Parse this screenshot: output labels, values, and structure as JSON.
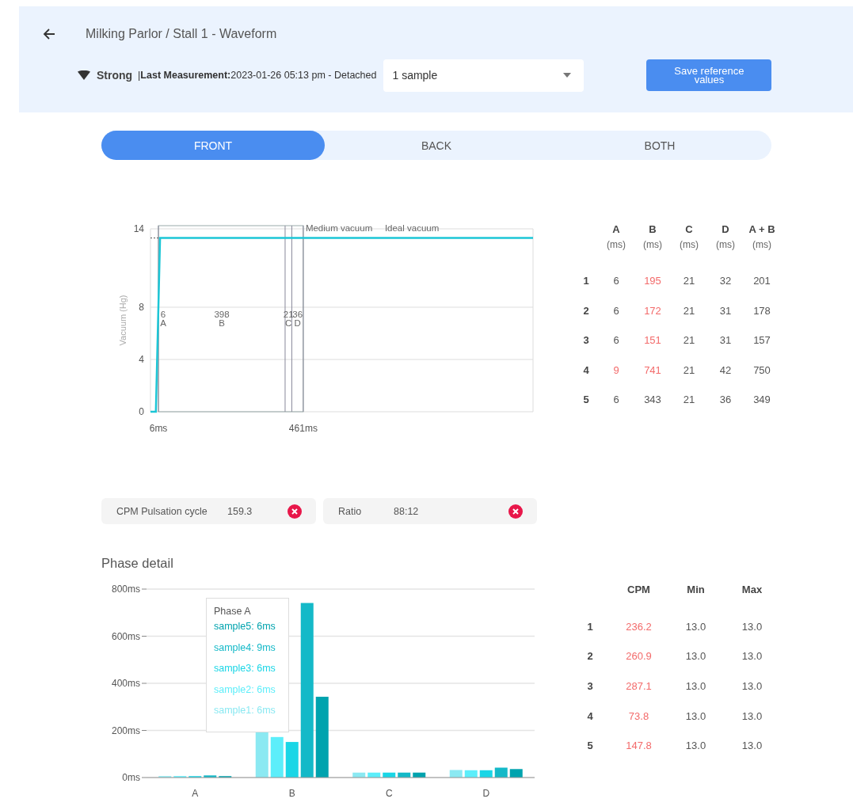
{
  "header": {
    "title": "Milking Parlor / Stall 1 - Waveform",
    "signal": "Strong",
    "measurement": "|**Last Measurement:**2023-01-26 05:13 pm - Detached",
    "sample_select": {
      "value": "1 sample"
    },
    "save_button": "Save reference values"
  },
  "tabs": [
    {
      "label": "FRONT",
      "selected": true
    },
    {
      "label": "BACK",
      "selected": false
    },
    {
      "label": "BOTH",
      "selected": false
    }
  ],
  "waveform": {
    "chart_data": {
      "type": "line",
      "ylabel": "Vacuum (Hg)",
      "x": [
        -19,
        -2,
        11,
        1183
      ],
      "series": [
        {
          "color": "#1cc6d6",
          "values": [
            0,
            0,
            13.3,
            13.3
          ]
        }
      ],
      "xlim": [
        -19,
        1183
      ],
      "ylim": [
        0,
        14
      ],
      "xticks": [
        {
          "value": 6,
          "label": "6ms"
        },
        {
          "value": 461,
          "label": "461ms"
        }
      ],
      "yticks": [
        0,
        4,
        8,
        14
      ],
      "grid": true,
      "annotations": [
        "6",
        "A",
        "398",
        "B",
        "21",
        "C",
        "36",
        "D",
        "Medium vacuum",
        "Ideal vacuum"
      ]
    }
  },
  "phase_table": {
    "columns": [
      {
        "name": "A",
        "unit": "(ms)"
      },
      {
        "name": "B",
        "unit": "(ms)"
      },
      {
        "name": "C",
        "unit": "(ms)"
      },
      {
        "name": "D",
        "unit": "(ms)"
      },
      {
        "name": "A + B",
        "unit": "(ms)"
      }
    ],
    "rows": [
      {
        "index": "1",
        "cells": [
          {
            "text": "6",
            "alert": false
          },
          {
            "text": "195",
            "alert": true
          },
          {
            "text": "21",
            "alert": false
          },
          {
            "text": "32",
            "alert": false
          },
          {
            "text": "201",
            "alert": false
          }
        ]
      },
      {
        "index": "2",
        "cells": [
          {
            "text": "6",
            "alert": false
          },
          {
            "text": "172",
            "alert": true
          },
          {
            "text": "21",
            "alert": false
          },
          {
            "text": "31",
            "alert": false
          },
          {
            "text": "178",
            "alert": false
          }
        ]
      },
      {
        "index": "3",
        "cells": [
          {
            "text": "6",
            "alert": false
          },
          {
            "text": "151",
            "alert": true
          },
          {
            "text": "21",
            "alert": false
          },
          {
            "text": "31",
            "alert": false
          },
          {
            "text": "157",
            "alert": false
          }
        ]
      },
      {
        "index": "4",
        "cells": [
          {
            "text": "9",
            "alert": true
          },
          {
            "text": "741",
            "alert": true
          },
          {
            "text": "21",
            "alert": false
          },
          {
            "text": "42",
            "alert": false
          },
          {
            "text": "750",
            "alert": false
          }
        ]
      },
      {
        "index": "5",
        "cells": [
          {
            "text": "6",
            "alert": false
          },
          {
            "text": "343",
            "alert": false
          },
          {
            "text": "21",
            "alert": false
          },
          {
            "text": "36",
            "alert": false
          },
          {
            "text": "349",
            "alert": false
          }
        ]
      }
    ]
  },
  "metrics": [
    {
      "label": "CPM Pulsation cycle",
      "value": "159.3",
      "error": true
    },
    {
      "label": "Ratio",
      "value": "88:12",
      "error": true
    }
  ],
  "phase_detail": {
    "title": "Phase detail",
    "chart_data": {
      "type": "bar",
      "categories": [
        "A",
        "B",
        "C",
        "D"
      ],
      "series": [
        {
          "color": "#8be9f2",
          "values": [
            6,
            195,
            21,
            32
          ]
        },
        {
          "color": "#5ceefa",
          "values": [
            6,
            172,
            21,
            31
          ]
        },
        {
          "color": "#1ad6e6",
          "values": [
            6,
            151,
            21,
            31
          ]
        },
        {
          "color": "#14b9c8",
          "values": [
            9,
            741,
            21,
            42
          ]
        },
        {
          "color": "#00a3ae",
          "values": [
            6,
            343,
            21,
            36
          ]
        }
      ],
      "ylim": [
        0,
        800
      ],
      "grid": true,
      "yticks": [
        {
          "value": 0,
          "label": "0ms"
        },
        {
          "value": 200,
          "label": "200ms"
        },
        {
          "value": 400,
          "label": "400ms"
        },
        {
          "value": 600,
          "label": "600ms"
        },
        {
          "value": 800,
          "label": "800ms"
        }
      ]
    },
    "tooltip": {
      "title": "Phase A",
      "lines": [
        {
          "text": "sample5: 6ms",
          "color": "#00a3ae"
        },
        {
          "text": "sample4: 9ms",
          "color": "#14b9c8"
        },
        {
          "text": "sample3: 6ms",
          "color": "#1ad6e6"
        },
        {
          "text": "sample2: 6ms",
          "color": "#5ceefa"
        },
        {
          "text": "sample1: 6ms",
          "color": "#8be9f2"
        }
      ]
    }
  },
  "cpm_table": {
    "columns": [
      "CPM",
      "Min",
      "Max"
    ],
    "rows": [
      {
        "index": "1",
        "cells": [
          {
            "text": "236.2",
            "alert": true
          },
          {
            "text": "13.0",
            "alert": false
          },
          {
            "text": "13.0",
            "alert": false
          }
        ]
      },
      {
        "index": "2",
        "cells": [
          {
            "text": "260.9",
            "alert": true
          },
          {
            "text": "13.0",
            "alert": false
          },
          {
            "text": "13.0",
            "alert": false
          }
        ]
      },
      {
        "index": "3",
        "cells": [
          {
            "text": "287.1",
            "alert": true
          },
          {
            "text": "13.0",
            "alert": false
          },
          {
            "text": "13.0",
            "alert": false
          }
        ]
      },
      {
        "index": "4",
        "cells": [
          {
            "text": "73.8",
            "alert": true
          },
          {
            "text": "13.0",
            "alert": false
          },
          {
            "text": "13.0",
            "alert": false
          }
        ]
      },
      {
        "index": "5",
        "cells": [
          {
            "text": "147.8",
            "alert": true
          },
          {
            "text": "13.0",
            "alert": false
          },
          {
            "text": "13.0",
            "alert": false
          }
        ]
      }
    ]
  }
}
